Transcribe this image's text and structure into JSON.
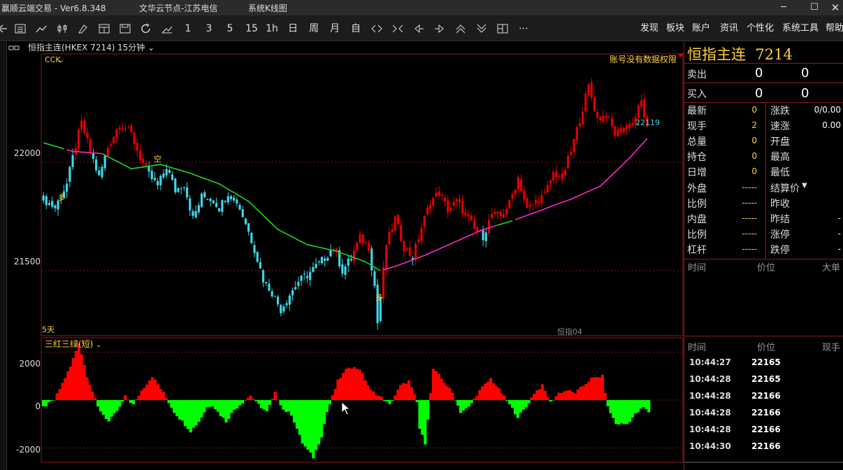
{
  "window": {
    "app_title": "赢顺云端交易  - Ver6.8.348",
    "server": "文华云节点-江苏电信",
    "sys_menu": "系统K线图",
    "minimize": "─",
    "maximize": "☐",
    "close": "✕"
  },
  "toolbar": {
    "periods": [
      "1",
      "3",
      "5",
      "15",
      "1h",
      "日",
      "周",
      "月",
      "自"
    ],
    "more": "⋯",
    "menus": [
      "发现",
      "板块",
      "账户",
      "资讯",
      "个性化",
      "系统工具",
      "帮助"
    ]
  },
  "chart_header": {
    "symbol": "恒指主连(HKEX 7214)",
    "period": "15分钟"
  },
  "main_chart": {
    "indicator": "CCK",
    "notice": "账号没有数据权限",
    "last_price_label": "22119",
    "y_ticks": [
      22000,
      21500
    ],
    "range_label": "5天",
    "contract_label": "恒指04",
    "signals": [
      "多",
      "空",
      "多"
    ]
  },
  "sub_chart": {
    "indicator": "三红三绿(短)",
    "y_ticks": [
      2000,
      0,
      -2000
    ]
  },
  "quote_panel": {
    "title": "恒指主连",
    "code": "7214",
    "sell_label": "卖出",
    "sell_price": "0",
    "sell_vol": "0",
    "buy_label": "买入",
    "buy_price": "0",
    "buy_vol": "0",
    "left_rows": [
      {
        "label": "最新",
        "value": "0"
      },
      {
        "label": "现手",
        "value": "2"
      },
      {
        "label": "总量",
        "value": "0"
      },
      {
        "label": "持仓",
        "value": "0"
      },
      {
        "label": "日增",
        "value": "0"
      },
      {
        "label": "外盘",
        "value": "-----"
      },
      {
        "label": "比例",
        "value": "-----"
      },
      {
        "label": "内盘",
        "value": "-----"
      },
      {
        "label": "比例",
        "value": "-----"
      },
      {
        "label": "杠杆",
        "value": "-----"
      }
    ],
    "right_rows": [
      {
        "label": "涨跌",
        "value": "0/0.00"
      },
      {
        "label": "速涨",
        "value": "0.00"
      },
      {
        "label": "开盘",
        "value": ""
      },
      {
        "label": "最高",
        "value": ""
      },
      {
        "label": "最低",
        "value": ""
      },
      {
        "label": "结算价",
        "value": ""
      },
      {
        "label": "昨收",
        "value": ""
      },
      {
        "label": "昨结",
        "value": "-"
      },
      {
        "label": "涨停",
        "value": "-"
      },
      {
        "label": "跌停",
        "value": "-"
      }
    ],
    "cols1": [
      "时间",
      "价位",
      "大单"
    ],
    "cols2": [
      "时间",
      "价位",
      "现手"
    ],
    "ticks": [
      {
        "time": "10:44:27",
        "price": "22165"
      },
      {
        "time": "10:44:28",
        "price": "22165"
      },
      {
        "time": "10:44:28",
        "price": "22166"
      },
      {
        "time": "10:44:28",
        "price": "22166"
      },
      {
        "time": "10:44:28",
        "price": "22166"
      },
      {
        "time": "10:44:30",
        "price": "22166"
      }
    ]
  },
  "chart_data": [
    {
      "type": "candlestick",
      "title": "CCK",
      "ylim": [
        21200,
        22500
      ],
      "y_ticks": [
        22000,
        21500
      ],
      "close_anchors": [
        [
          0,
          21830
        ],
        [
          4,
          21790
        ],
        [
          8,
          21900
        ],
        [
          11,
          22080
        ],
        [
          13,
          22180
        ],
        [
          16,
          22050
        ],
        [
          19,
          21930
        ],
        [
          22,
          22070
        ],
        [
          26,
          22180
        ],
        [
          30,
          22130
        ],
        [
          33,
          22020
        ],
        [
          36,
          21940
        ],
        [
          39,
          21890
        ],
        [
          42,
          21980
        ],
        [
          45,
          21870
        ],
        [
          48,
          21900
        ],
        [
          51,
          21740
        ],
        [
          54,
          21840
        ],
        [
          57,
          21840
        ],
        [
          60,
          21790
        ],
        [
          63,
          21860
        ],
        [
          66,
          21820
        ],
        [
          69,
          21720
        ],
        [
          72,
          21600
        ],
        [
          75,
          21460
        ],
        [
          78,
          21400
        ],
        [
          81,
          21320
        ],
        [
          84,
          21390
        ],
        [
          87,
          21450
        ],
        [
          90,
          21480
        ],
        [
          93,
          21520
        ],
        [
          96,
          21560
        ],
        [
          99,
          21610
        ],
        [
          102,
          21500
        ],
        [
          105,
          21560
        ],
        [
          108,
          21650
        ],
        [
          111,
          21610
        ],
        [
          113,
          21430
        ],
        [
          114,
          21260
        ],
        [
          117,
          21620
        ],
        [
          120,
          21740
        ],
        [
          123,
          21610
        ],
        [
          126,
          21560
        ],
        [
          129,
          21700
        ],
        [
          132,
          21820
        ],
        [
          135,
          21860
        ],
        [
          138,
          21780
        ],
        [
          141,
          21820
        ],
        [
          144,
          21760
        ],
        [
          147,
          21690
        ],
        [
          150,
          21660
        ],
        [
          153,
          21760
        ],
        [
          156,
          21750
        ],
        [
          159,
          21810
        ],
        [
          162,
          21930
        ],
        [
          165,
          21780
        ],
        [
          168,
          21820
        ],
        [
          171,
          21850
        ],
        [
          174,
          21950
        ],
        [
          177,
          21930
        ],
        [
          180,
          22050
        ],
        [
          183,
          22200
        ],
        [
          186,
          22350
        ],
        [
          189,
          22200
        ],
        [
          192,
          22220
        ],
        [
          195,
          22130
        ],
        [
          198,
          22160
        ],
        [
          201,
          22180
        ],
        [
          204,
          22280
        ],
        [
          206,
          22150
        ]
      ],
      "ma_fast": [
        [
          0,
          22090
        ],
        [
          10,
          22050
        ],
        [
          20,
          22040
        ],
        [
          30,
          21970
        ],
        [
          40,
          21990
        ],
        [
          50,
          21950
        ],
        [
          60,
          21900
        ],
        [
          70,
          21820
        ],
        [
          80,
          21690
        ],
        [
          90,
          21620
        ],
        [
          100,
          21590
        ],
        [
          110,
          21540
        ],
        [
          115,
          21500
        ],
        [
          120,
          21520
        ],
        [
          130,
          21570
        ],
        [
          140,
          21630
        ],
        [
          150,
          21690
        ],
        [
          160,
          21730
        ],
        [
          170,
          21780
        ],
        [
          180,
          21830
        ],
        [
          190,
          21890
        ],
        [
          200,
          22020
        ],
        [
          206,
          22110
        ]
      ],
      "ma_colors": {
        "up": "#e00000",
        "down": "#3ed6e8",
        "ma_green": "#1ed81e",
        "ma_pink": "#ff26c8"
      }
    },
    {
      "type": "bar",
      "title": "三红三绿(短)",
      "ylim": [
        -2600,
        2600
      ],
      "y_ticks": [
        2000,
        0,
        -2000
      ],
      "value_anchors": [
        [
          0,
          -300
        ],
        [
          4,
          0
        ],
        [
          10,
          1400
        ],
        [
          13,
          2400
        ],
        [
          16,
          1000
        ],
        [
          20,
          -300
        ],
        [
          24,
          -900
        ],
        [
          28,
          -300
        ],
        [
          30,
          150
        ],
        [
          33,
          -200
        ],
        [
          36,
          400
        ],
        [
          40,
          1000
        ],
        [
          44,
          300
        ],
        [
          48,
          -500
        ],
        [
          51,
          -900
        ],
        [
          54,
          -1300
        ],
        [
          57,
          -900
        ],
        [
          60,
          -300
        ],
        [
          62,
          -200
        ],
        [
          64,
          -500
        ],
        [
          67,
          -900
        ],
        [
          70,
          -400
        ],
        [
          73,
          -100
        ],
        [
          76,
          200
        ],
        [
          78,
          -100
        ],
        [
          80,
          -300
        ],
        [
          82,
          -500
        ],
        [
          85,
          300
        ],
        [
          88,
          -400
        ],
        [
          91,
          -600
        ],
        [
          95,
          -1800
        ],
        [
          99,
          -2400
        ],
        [
          102,
          -1500
        ],
        [
          104,
          -500
        ],
        [
          108,
          800
        ],
        [
          112,
          1400
        ],
        [
          116,
          1300
        ],
        [
          120,
          400
        ],
        [
          124,
          100
        ],
        [
          127,
          -200
        ],
        [
          131,
          600
        ],
        [
          134,
          800
        ],
        [
          137,
          -100
        ],
        [
          138,
          -1200
        ],
        [
          140,
          -1800
        ],
        [
          143,
          1300
        ],
        [
          146,
          900
        ],
        [
          150,
          300
        ],
        [
          153,
          -500
        ],
        [
          156,
          -300
        ],
        [
          160,
          400
        ],
        [
          164,
          900
        ],
        [
          168,
          300
        ],
        [
          171,
          -200
        ],
        [
          174,
          -700
        ],
        [
          177,
          -300
        ],
        [
          180,
          300
        ],
        [
          183,
          600
        ],
        [
          186,
          -100
        ],
        [
          189,
          300
        ],
        [
          192,
          400
        ],
        [
          195,
          300
        ],
        [
          198,
          600
        ],
        [
          201,
          900
        ],
        [
          205,
          1000
        ],
        [
          207,
          -300
        ],
        [
          210,
          -1000
        ],
        [
          214,
          -1000
        ],
        [
          217,
          -600
        ],
        [
          220,
          -300
        ],
        [
          222,
          -500
        ]
      ],
      "colors": {
        "pos": "#ff0000",
        "neg": "#00ff00"
      }
    }
  ]
}
